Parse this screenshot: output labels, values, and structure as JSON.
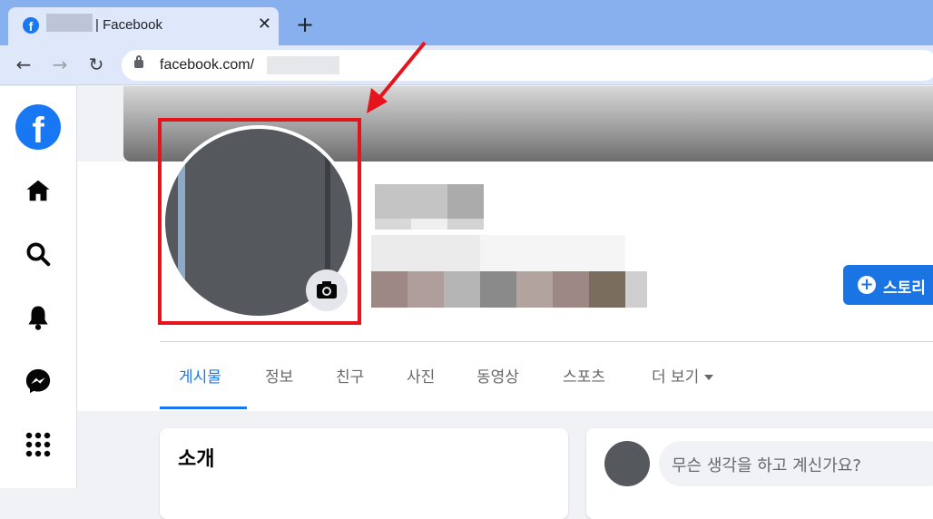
{
  "browser": {
    "tab_title": "| Facebook",
    "tab_close": "✕",
    "new_tab": "+",
    "back": "←",
    "forward": "→",
    "reload": "↻",
    "url": "facebook.com/"
  },
  "rail": {
    "logo": "f"
  },
  "profile": {
    "story_button": "스토리"
  },
  "tabs": [
    "게시물",
    "정보",
    "친구",
    "사진",
    "동영상",
    "스포츠",
    "더 보기"
  ],
  "intro": {
    "title": "소개"
  },
  "composer": {
    "placeholder": "무슨 생각을 하고 계신가요?"
  },
  "colors": {
    "facebook_blue": "#1877f2",
    "highlight_red": "#e5141c",
    "rail_icon": "#050505"
  }
}
